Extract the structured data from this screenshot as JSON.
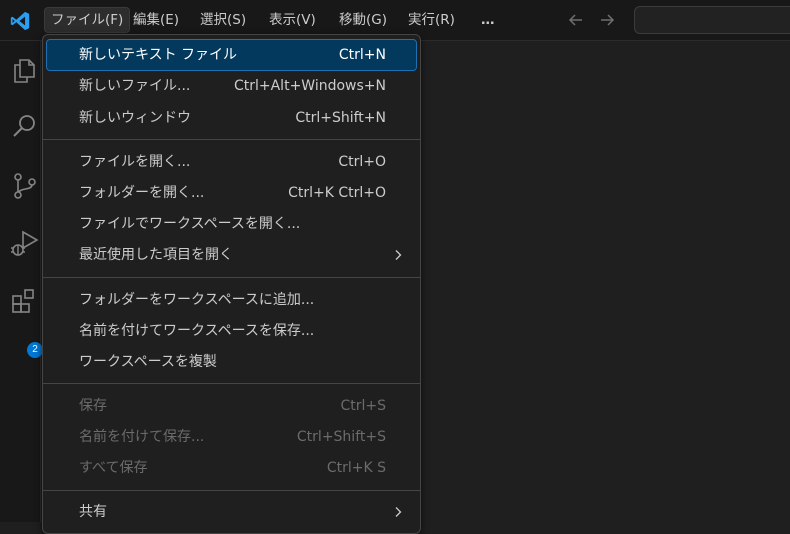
{
  "menubar": {
    "items": [
      "ファイル(F)",
      "編集(E)",
      "選択(S)",
      "表示(V)",
      "移動(G)",
      "実行(R)",
      "…"
    ]
  },
  "activity": {
    "extensions_badge": "2"
  },
  "file_menu": {
    "groups": [
      [
        {
          "label": "新しいテキスト ファイル",
          "shortcut": "Ctrl+N"
        },
        {
          "label": "新しいファイル...",
          "shortcut": "Ctrl+Alt+Windows+N"
        },
        {
          "label": "新しいウィンドウ",
          "shortcut": "Ctrl+Shift+N"
        }
      ],
      [
        {
          "label": "ファイルを開く...",
          "shortcut": "Ctrl+O"
        },
        {
          "label": "フォルダーを開く...",
          "shortcut": "Ctrl+K Ctrl+O"
        },
        {
          "label": "ファイルでワークスペースを開く...",
          "shortcut": ""
        },
        {
          "label": "最近使用した項目を開く",
          "shortcut": ""
        }
      ],
      [
        {
          "label": "フォルダーをワークスペースに追加...",
          "shortcut": ""
        },
        {
          "label": "名前を付けてワークスペースを保存...",
          "shortcut": ""
        },
        {
          "label": "ワークスペースを複製",
          "shortcut": ""
        }
      ],
      [
        {
          "label": "保存",
          "shortcut": "Ctrl+S"
        },
        {
          "label": "名前を付けて保存...",
          "shortcut": "Ctrl+Shift+S"
        },
        {
          "label": "すべて保存",
          "shortcut": "Ctrl+K S"
        }
      ],
      [
        {
          "label": "共有",
          "shortcut": ""
        }
      ]
    ]
  },
  "colors": {
    "accent": "#0078d4",
    "highlight": "#04395e",
    "background": "#1f1f1f"
  }
}
